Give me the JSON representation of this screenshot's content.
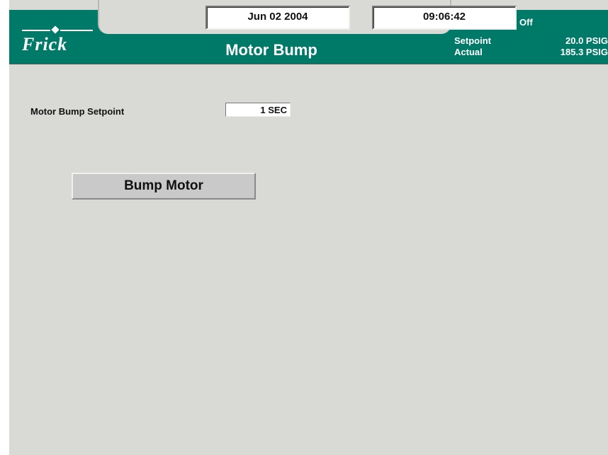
{
  "header": {
    "brand": "Frick",
    "date": "Jun 02 2004",
    "time": "09:06:42",
    "title": "Motor Bump",
    "status": {
      "state": "Off",
      "setpoint_label": "Setpoint",
      "setpoint_value": "20.0 PSIG",
      "actual_label": "Actual",
      "actual_value": "185.3 PSIG"
    },
    "colors": {
      "band": "#007a68",
      "background": "#d9d9d6"
    }
  },
  "main": {
    "setpoint_label": "Motor Bump Setpoint",
    "setpoint_value": "1 SEC",
    "bump_button_label": "Bump Motor"
  }
}
